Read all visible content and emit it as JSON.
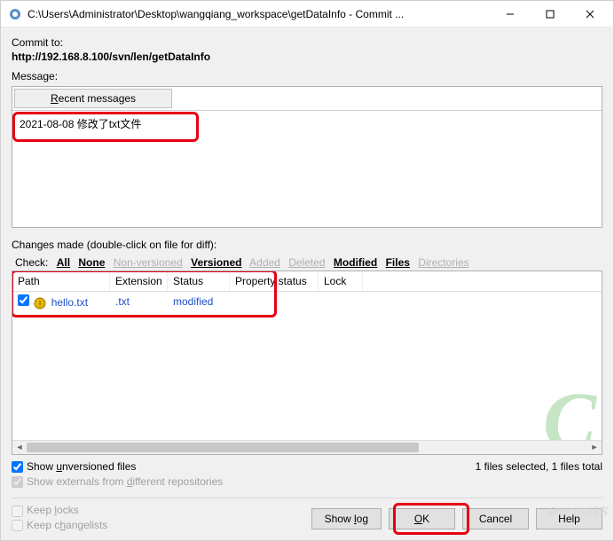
{
  "titlebar": {
    "title": "C:\\Users\\Administrator\\Desktop\\wangqiang_workspace\\getDataInfo - Commit ..."
  },
  "commit": {
    "label": "Commit to:",
    "url": "http://192.168.8.100/svn/len/getDataInfo"
  },
  "message": {
    "label": "Message:",
    "recent_label": "Recent messages",
    "value": "2021-08-08 修改了txt文件"
  },
  "changes": {
    "label": "Changes made (double-click on file for diff):",
    "check_label": "Check:",
    "filters": {
      "all": "All",
      "none": "None",
      "nonversioned": "Non-versioned",
      "versioned": "Versioned",
      "added": "Added",
      "deleted": "Deleted",
      "modified": "Modified",
      "files": "Files",
      "directories": "Directories"
    },
    "columns": {
      "path": "Path",
      "extension": "Extension",
      "status": "Status",
      "property_status": "Property status",
      "lock": "Lock"
    },
    "rows": [
      {
        "checked": true,
        "path": "hello.txt",
        "extension": ".txt",
        "status": "modified",
        "property_status": "",
        "lock": ""
      }
    ]
  },
  "options": {
    "show_unversioned": "Show unversioned files",
    "show_externals": "Show externals from different repositories",
    "keep_locks": "Keep locks",
    "keep_changelists": "Keep changelists"
  },
  "status": {
    "text": "1 files selected, 1 files total"
  },
  "buttons": {
    "show_log": "Show log",
    "ok": "OK",
    "cancel": "Cancel",
    "help": "Help"
  },
  "watermark": "@51CTO博客"
}
